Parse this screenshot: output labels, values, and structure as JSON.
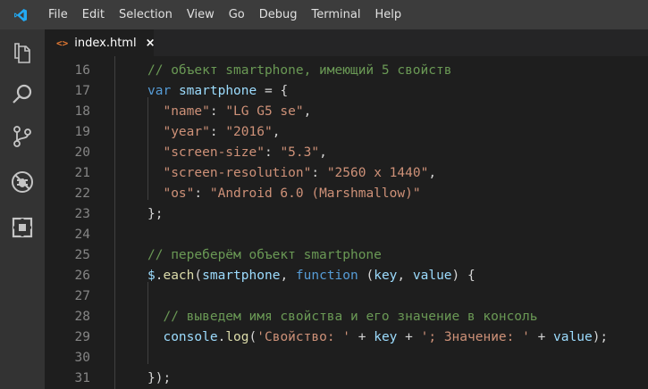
{
  "menu": [
    "File",
    "Edit",
    "Selection",
    "View",
    "Go",
    "Debug",
    "Terminal",
    "Help"
  ],
  "activity_icons": [
    "files-icon",
    "search-icon",
    "source-control-icon",
    "debug-icon",
    "extensions-icon"
  ],
  "tab": {
    "icon": "<>",
    "label": "index.html",
    "close": "×"
  },
  "colors": {
    "comment": "#6a9955",
    "keyword": "#569cd6",
    "variable": "#9cdcfe",
    "string": "#ce9178",
    "function": "#dcdcaa",
    "punctuation": "#d4d4d4",
    "accent": "#007acc"
  },
  "lines": [
    {
      "n": "16",
      "tokens": [
        [
          "com",
          "// объект smartphone, имеющий 5 свойств"
        ]
      ]
    },
    {
      "n": "17",
      "tokens": [
        [
          "kw",
          "var"
        ],
        [
          "pun",
          " "
        ],
        [
          "var",
          "smartphone"
        ],
        [
          "pun",
          " = {"
        ]
      ]
    },
    {
      "n": "18",
      "tokens": [
        [
          "pun",
          "  "
        ],
        [
          "str",
          "\"name\""
        ],
        [
          "pun",
          ": "
        ],
        [
          "str",
          "\"LG G5 se\""
        ],
        [
          "pun",
          ","
        ]
      ]
    },
    {
      "n": "19",
      "tokens": [
        [
          "pun",
          "  "
        ],
        [
          "str",
          "\"year\""
        ],
        [
          "pun",
          ": "
        ],
        [
          "str",
          "\"2016\""
        ],
        [
          "pun",
          ","
        ]
      ]
    },
    {
      "n": "20",
      "tokens": [
        [
          "pun",
          "  "
        ],
        [
          "str",
          "\"screen-size\""
        ],
        [
          "pun",
          ": "
        ],
        [
          "str",
          "\"5.3\""
        ],
        [
          "pun",
          ","
        ]
      ]
    },
    {
      "n": "21",
      "tokens": [
        [
          "pun",
          "  "
        ],
        [
          "str",
          "\"screen-resolution\""
        ],
        [
          "pun",
          ": "
        ],
        [
          "str",
          "\"2560 x 1440\""
        ],
        [
          "pun",
          ","
        ]
      ]
    },
    {
      "n": "22",
      "tokens": [
        [
          "pun",
          "  "
        ],
        [
          "str",
          "\"os\""
        ],
        [
          "pun",
          ": "
        ],
        [
          "str",
          "\"Android 6.0 (Marshmallow)\""
        ]
      ]
    },
    {
      "n": "23",
      "tokens": [
        [
          "pun",
          "};"
        ]
      ]
    },
    {
      "n": "24",
      "tokens": []
    },
    {
      "n": "25",
      "tokens": [
        [
          "com",
          "// переберём объект smartphone"
        ]
      ]
    },
    {
      "n": "26",
      "tokens": [
        [
          "var",
          "$"
        ],
        [
          "pun",
          "."
        ],
        [
          "fn",
          "each"
        ],
        [
          "pun",
          "("
        ],
        [
          "var",
          "smartphone"
        ],
        [
          "pun",
          ", "
        ],
        [
          "kw",
          "function"
        ],
        [
          "pun",
          " ("
        ],
        [
          "var",
          "key"
        ],
        [
          "pun",
          ", "
        ],
        [
          "var",
          "value"
        ],
        [
          "pun",
          ") {"
        ]
      ]
    },
    {
      "n": "27",
      "tokens": []
    },
    {
      "n": "28",
      "tokens": [
        [
          "pun",
          "  "
        ],
        [
          "com",
          "// выведем имя свойства и его значение в консоль"
        ]
      ]
    },
    {
      "n": "29",
      "tokens": [
        [
          "pun",
          "  "
        ],
        [
          "var",
          "console"
        ],
        [
          "pun",
          "."
        ],
        [
          "fn",
          "log"
        ],
        [
          "pun",
          "("
        ],
        [
          "str",
          "'Свойство: '"
        ],
        [
          "pun",
          " + "
        ],
        [
          "var",
          "key"
        ],
        [
          "pun",
          " + "
        ],
        [
          "str",
          "'; Значение: '"
        ],
        [
          "pun",
          " + "
        ],
        [
          "var",
          "value"
        ],
        [
          "pun",
          ");"
        ]
      ]
    },
    {
      "n": "30",
      "tokens": []
    },
    {
      "n": "31",
      "tokens": [
        [
          "pun",
          "});"
        ]
      ]
    }
  ]
}
